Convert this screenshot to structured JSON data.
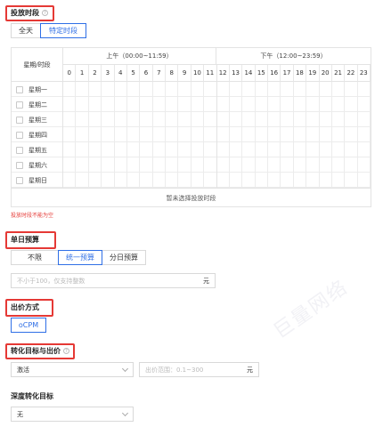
{
  "schedule": {
    "title": "投放时段",
    "help": "?",
    "modes": [
      "全天",
      "特定时段"
    ],
    "active_mode": 1,
    "header_label": "星期/时段",
    "am_label": "上午（00:00~11:59）",
    "pm_label": "下午（12:00~23:59）",
    "hours": [
      "0",
      "1",
      "2",
      "3",
      "4",
      "5",
      "6",
      "7",
      "8",
      "9",
      "10",
      "11",
      "12",
      "13",
      "14",
      "15",
      "16",
      "17",
      "18",
      "19",
      "20",
      "21",
      "22",
      "23"
    ],
    "days": [
      "星期一",
      "星期二",
      "星期三",
      "星期四",
      "星期五",
      "星期六",
      "星期日"
    ],
    "footer": "暂未选择投放时段",
    "error": "投放时段不能为空"
  },
  "budget": {
    "title": "单日预算",
    "options": [
      "不限",
      "统一预算",
      "分日预算"
    ],
    "active": 1,
    "placeholder": "不小于100，仅支持整数",
    "unit": "元"
  },
  "bid_method": {
    "title": "出价方式",
    "option": "oCPM"
  },
  "conversion": {
    "title": "转化目标与出价",
    "help": "?",
    "goal": "激活",
    "bid_placeholder": "出价范围：0.1~300",
    "unit": "元"
  },
  "deep_conversion": {
    "title": "深度转化目标",
    "value": "无"
  },
  "watermark": "巨量网络",
  "colors": {
    "accent": "#2f6fe6",
    "highlight": "#e53935",
    "error": "#e53935"
  }
}
